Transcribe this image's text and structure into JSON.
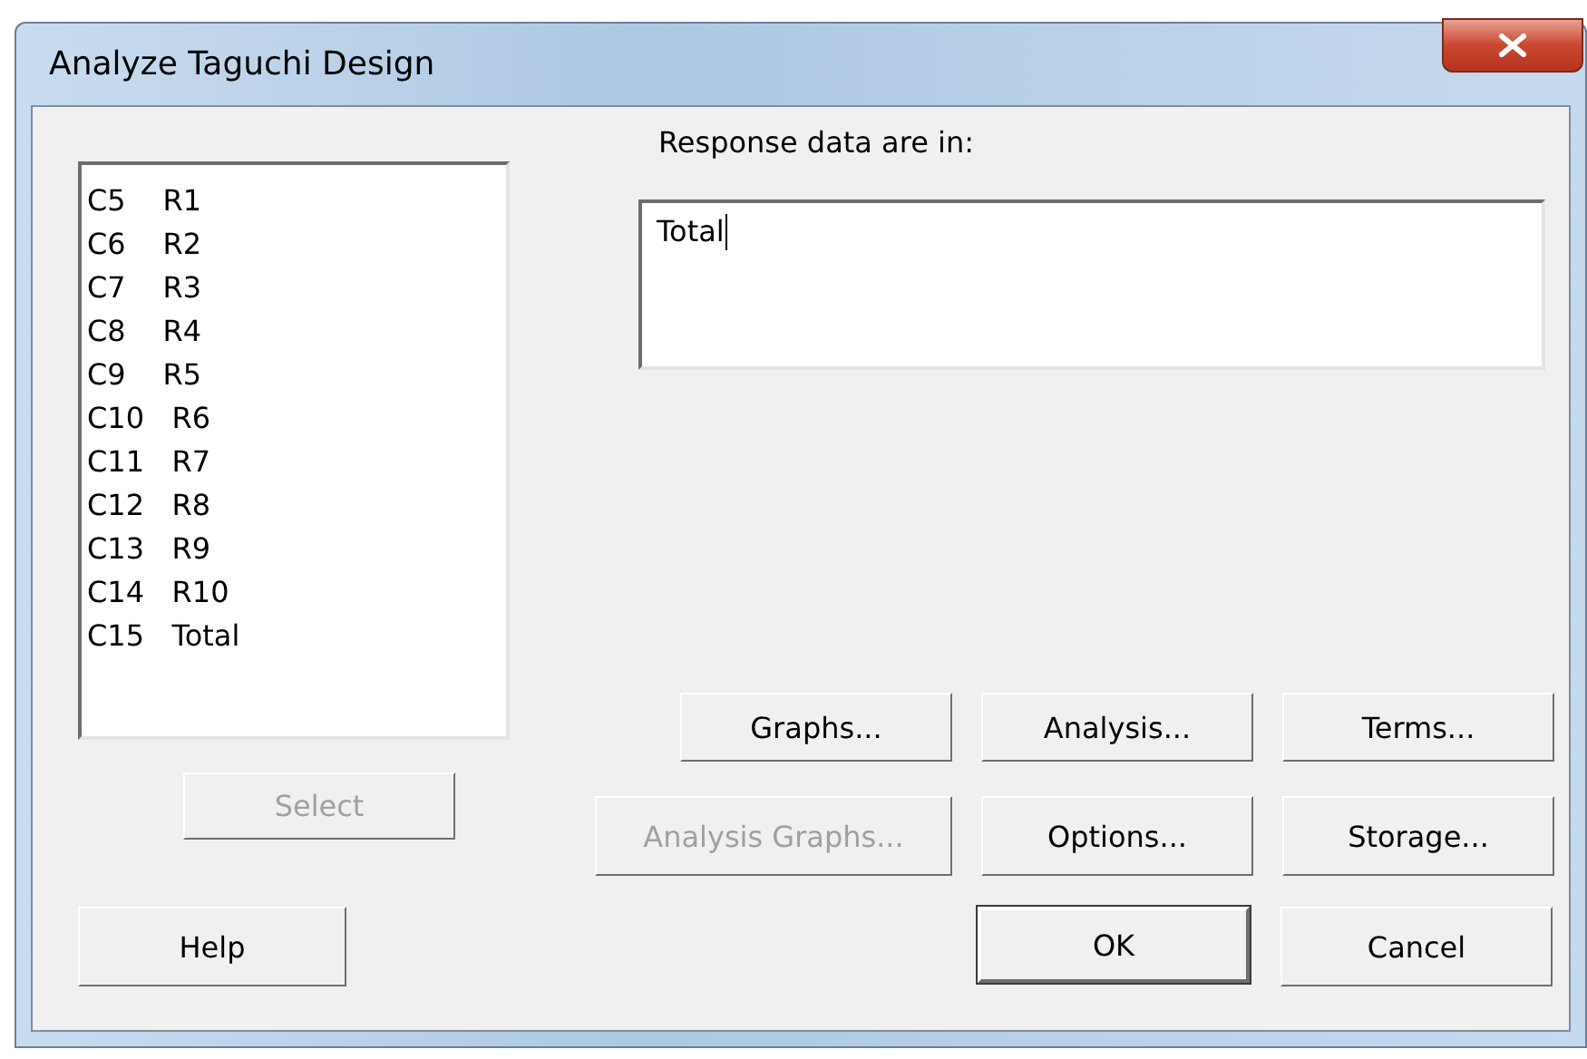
{
  "window": {
    "title": "Analyze Taguchi Design"
  },
  "variables": [
    "C5    R1",
    "C6    R2",
    "C7    R3",
    "C8    R4",
    "C9    R5",
    "C10   R6",
    "C11   R7",
    "C12   R8",
    "C13   R9",
    "C14   R10",
    "C15   Total"
  ],
  "select_button": {
    "label": "Select",
    "disabled": true
  },
  "response": {
    "label": "Response data are in:",
    "value": "Total"
  },
  "option_buttons": [
    {
      "label": "Graphs...",
      "disabled": false
    },
    {
      "label": "Analysis...",
      "disabled": false
    },
    {
      "label": "Terms...",
      "disabled": false
    },
    {
      "label": "Analysis Graphs...",
      "disabled": true
    },
    {
      "label": "Options...",
      "disabled": false
    },
    {
      "label": "Storage...",
      "disabled": false
    }
  ],
  "help_button": {
    "label": "Help"
  },
  "ok_button": {
    "label": "OK",
    "default": true
  },
  "cancel_button": {
    "label": "Cancel"
  }
}
